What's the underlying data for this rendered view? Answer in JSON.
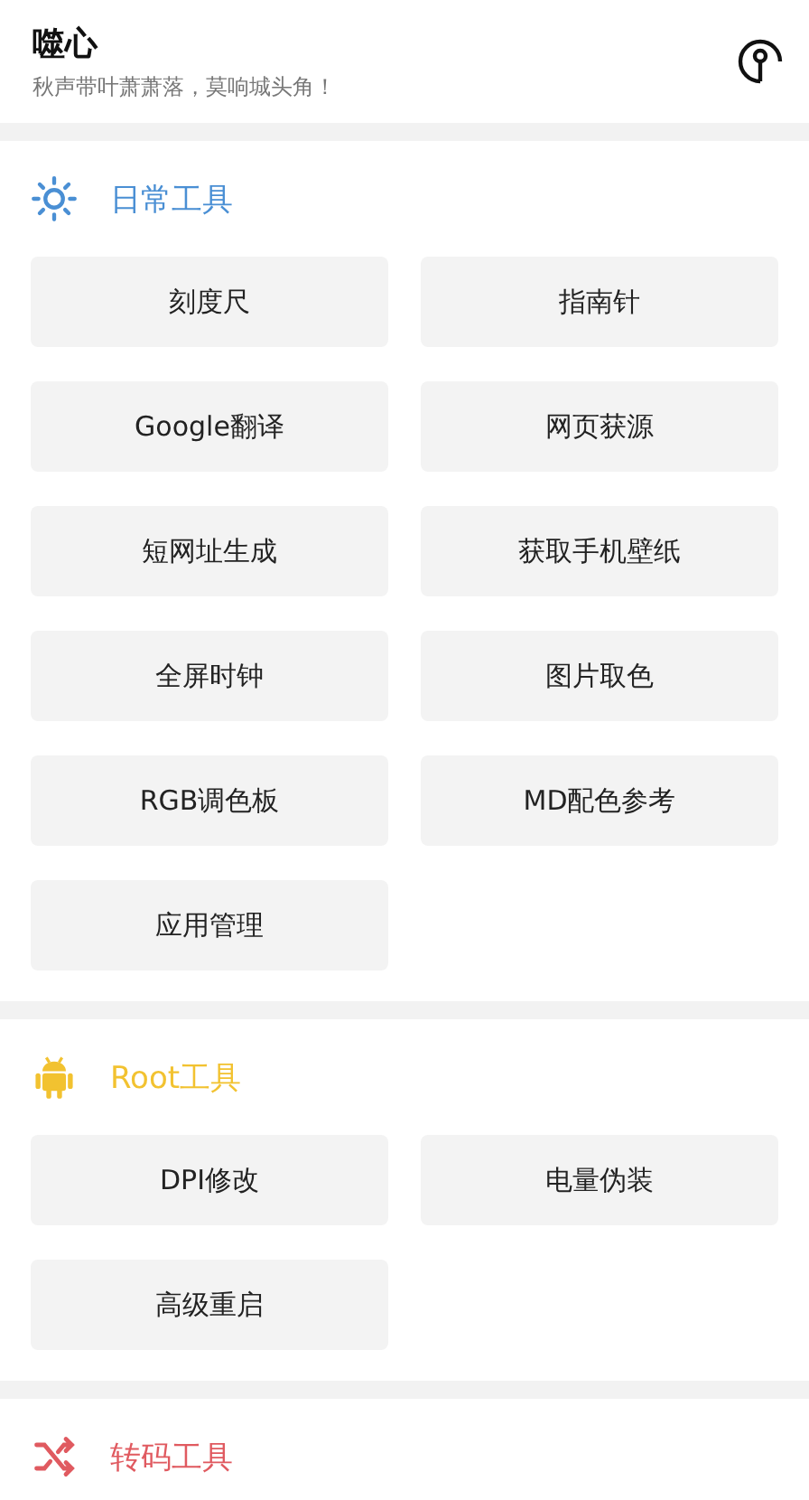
{
  "header": {
    "title": "噬心",
    "subtitle": "秋声带叶萧萧落，莫响城头角！"
  },
  "sections": [
    {
      "title": "日常工具",
      "kind": "sun",
      "color": "#4a8fd4",
      "tools": [
        "刻度尺",
        "指南针",
        "Google翻译",
        "网页获源",
        "短网址生成",
        "获取手机壁纸",
        "全屏时钟",
        "图片取色",
        "RGB调色板",
        "MD配色参考",
        "应用管理"
      ]
    },
    {
      "title": "Root工具",
      "kind": "android",
      "color": "#f2c230",
      "tools": [
        "DPI修改",
        "电量伪装",
        "高级重启"
      ]
    },
    {
      "title": "转码工具",
      "kind": "shuffle",
      "color": "#e05a60"
    }
  ]
}
